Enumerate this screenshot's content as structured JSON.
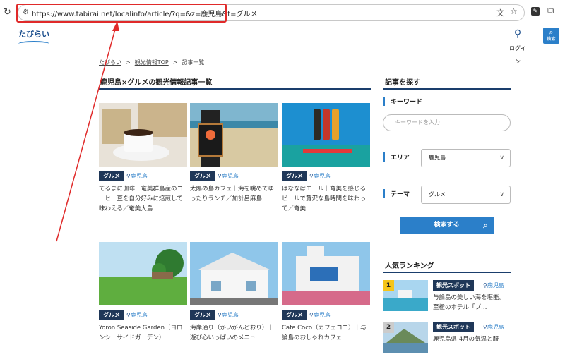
{
  "browser": {
    "url": "https://www.tabirai.net/localinfo/article/?q=&z=鹿児島&t=グルメ",
    "highlight_color": "#e02a2a"
  },
  "header": {
    "logo_text": "たびらい",
    "login_label": "ログイン",
    "search_label": "検索"
  },
  "breadcrumb": {
    "items": [
      "たびらい",
      "観光情報TOP",
      "記事一覧"
    ],
    "separator": ">"
  },
  "main": {
    "heading": "鹿児島×グルメの観光情報記事一覧",
    "cards": [
      {
        "tag": "グルメ",
        "location": "鹿児島",
        "desc": "てるまに珈琲｜奄美群島産のコーヒー豆を自分好みに焙煎して味わえる／奄美大島"
      },
      {
        "tag": "グルメ",
        "location": "鹿児島",
        "desc": "太陽の島カフェ｜海を眺めてゆったりランチ／加計呂麻島"
      },
      {
        "tag": "グルメ",
        "location": "鹿児島",
        "desc": "はななはエール｜奄美を感じるビールで贅沢な島時間を味わって／奄美"
      },
      {
        "tag": "グルメ",
        "location": "鹿児島",
        "desc": "Yoron Seaside Garden（ヨロンシーサイドガーデン）"
      },
      {
        "tag": "グルメ",
        "location": "鹿児島",
        "desc": "海岸通り（かいがんどおり）｜遊び心いっぱいのメニュ"
      },
      {
        "tag": "グルメ",
        "location": "鹿児島",
        "desc": "Cafe Coco（カフェココ）｜与論島のおしゃれカフェ"
      }
    ]
  },
  "sidebar": {
    "heading": "記事を探す",
    "keyword_label": "キーワード",
    "keyword_placeholder": "キーワードを入力",
    "area_label": "エリア",
    "area_value": "鹿児島",
    "theme_label": "テーマ",
    "theme_value": "グルメ",
    "search_button": "検索する",
    "ranking_heading": "人気ランキング",
    "ranking": [
      {
        "rank": "1",
        "tag": "観光スポット",
        "location": "鹿児島",
        "desc": "与論島の美しい海を堪能。至極のホテル「プ…"
      },
      {
        "rank": "2",
        "tag": "観光スポット",
        "location": "鹿児島",
        "desc": "鹿児島県 4月の気温と服"
      }
    ]
  },
  "colors": {
    "navy": "#1f3758",
    "accent": "#2b7fc9",
    "rank1": "#f5c518"
  }
}
